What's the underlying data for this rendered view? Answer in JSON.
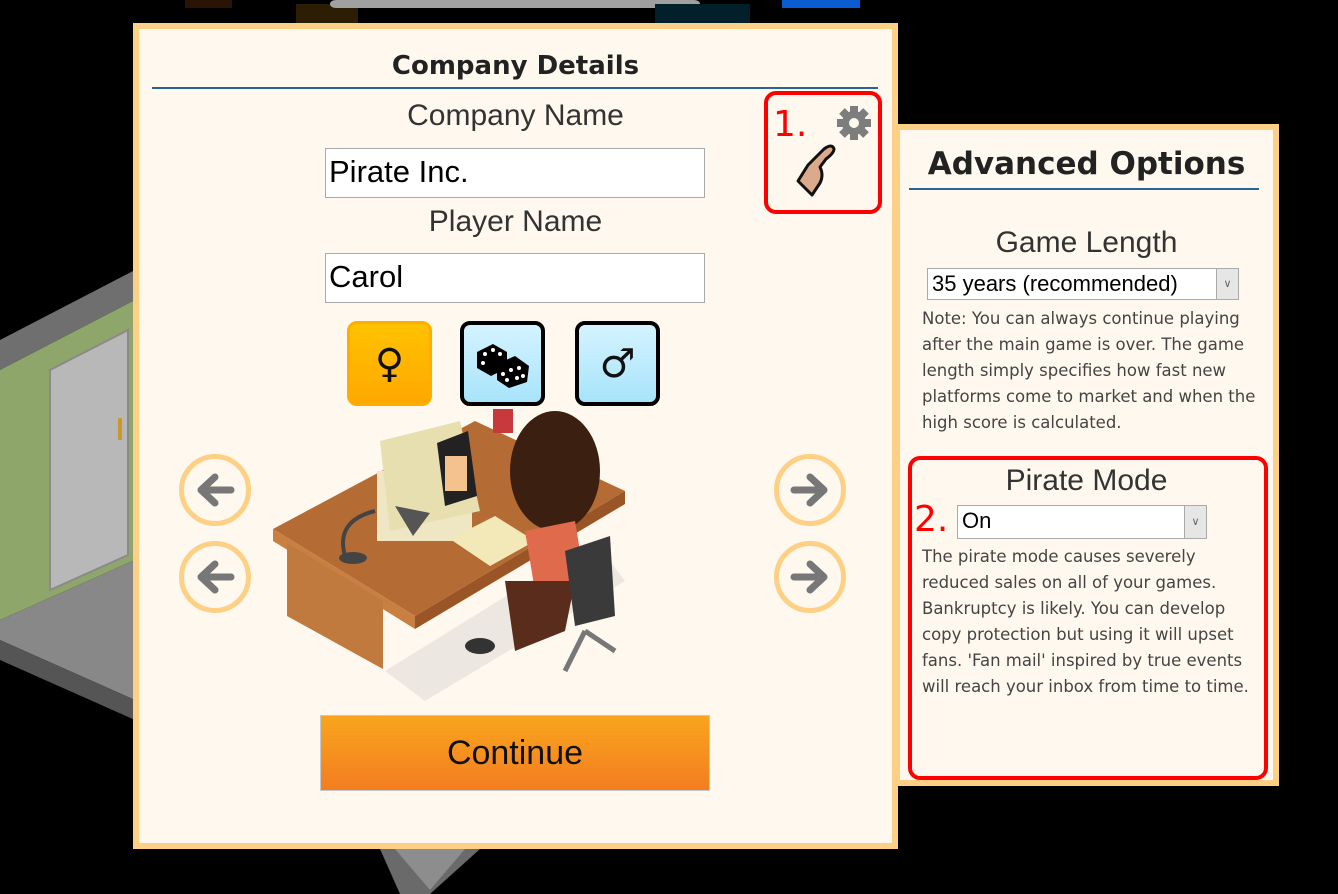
{
  "company_details": {
    "title": "Company Details",
    "company_name_label": "Company Name",
    "company_name_value": "Pirate Inc.",
    "player_name_label": "Player Name",
    "player_name_value": "Carol",
    "gender_buttons": [
      {
        "name": "female",
        "glyph": "♀",
        "selected": true
      },
      {
        "name": "random",
        "glyph": "dice",
        "selected": false
      },
      {
        "name": "male",
        "glyph": "♂",
        "selected": false
      }
    ],
    "continue_label": "Continue",
    "annotation_1": "1."
  },
  "advanced_options": {
    "title": "Advanced Options",
    "game_length_label": "Game Length",
    "game_length_value": "35 years (recommended)",
    "game_length_note": "Note: You can always continue playing after the main game is over. The game length simply specifies how fast new platforms come to market and when the high score is calculated.",
    "pirate_mode_label": "Pirate Mode",
    "pirate_mode_value": "On",
    "pirate_mode_note": "The pirate mode causes severely reduced sales on all of your games. Bankruptcy is likely. You can develop copy protection but using it will upset fans. 'Fan mail' inspired by true events will reach your inbox from time to time.",
    "annotation_2": "2."
  },
  "colors": {
    "panel_bg": "#fff8ee",
    "panel_border": "#fdd085",
    "accent_orange": "#f7941e",
    "annotation_red": "#ff0000",
    "rule_blue": "#2a6496"
  }
}
